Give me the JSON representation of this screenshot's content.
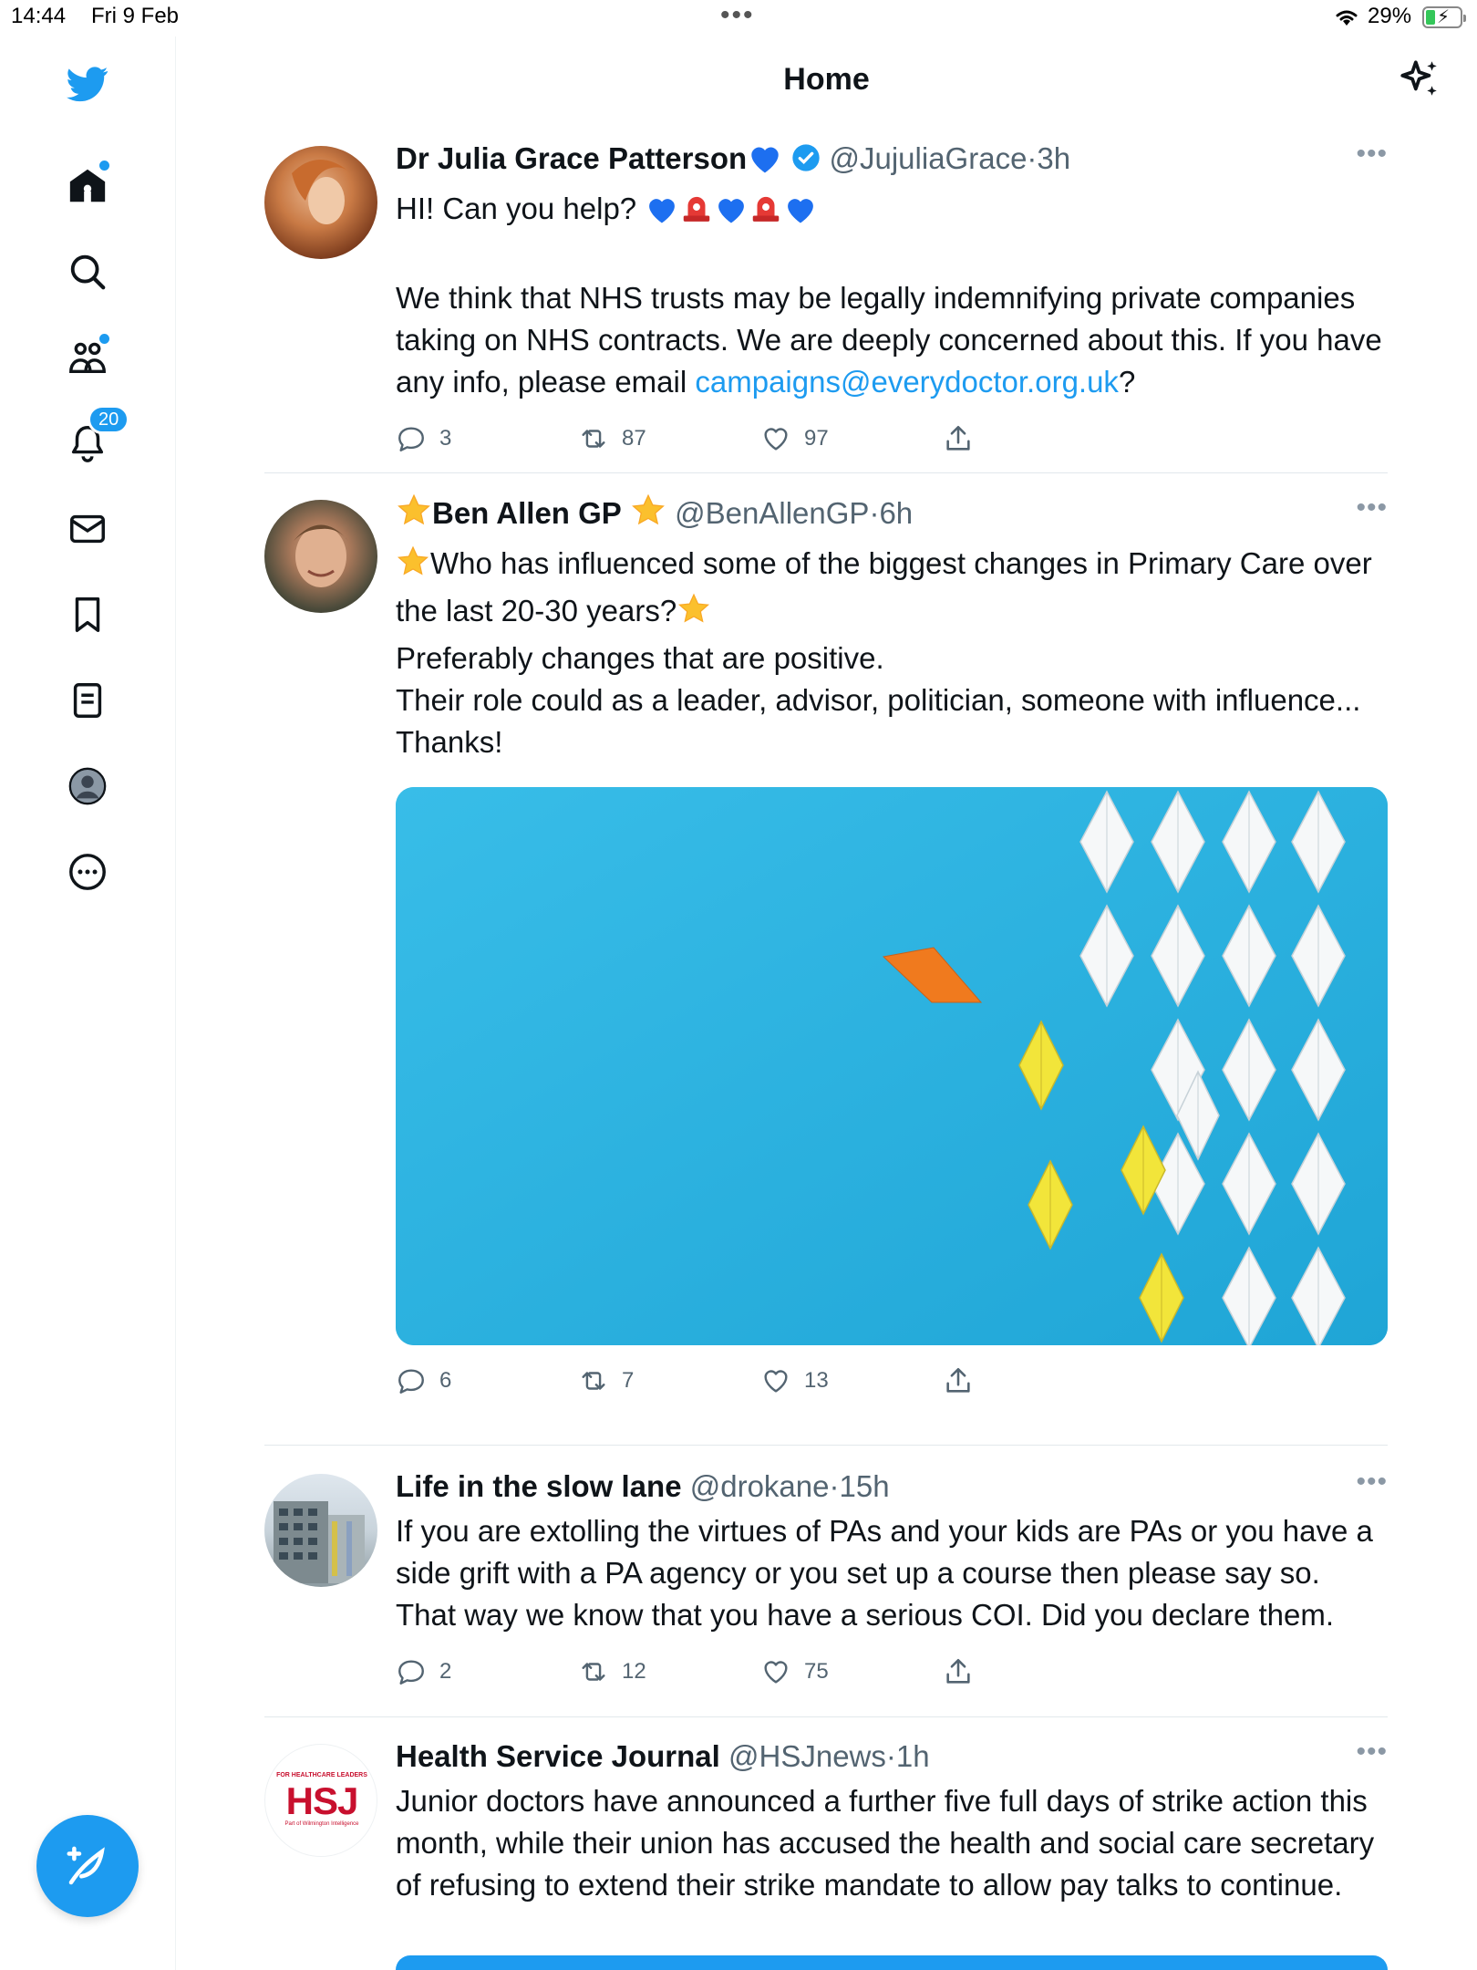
{
  "status_bar": {
    "time": "14:44",
    "date": "Fri 9 Feb",
    "battery": "29%"
  },
  "sidebar": {
    "items": [
      {
        "name": "home",
        "icon": "home-icon"
      },
      {
        "name": "explore",
        "icon": "search-icon"
      },
      {
        "name": "communities",
        "icon": "communities-icon"
      },
      {
        "name": "notifications",
        "icon": "bell-icon",
        "badge": "20"
      },
      {
        "name": "messages",
        "icon": "mail-icon"
      },
      {
        "name": "bookmarks",
        "icon": "bookmark-icon"
      },
      {
        "name": "lists",
        "icon": "lists-icon"
      },
      {
        "name": "profile",
        "icon": "profile-icon"
      },
      {
        "name": "more",
        "icon": "more-circle-icon"
      }
    ]
  },
  "header": {
    "title": "Home"
  },
  "tweets": [
    {
      "name": "Dr Julia Grace Patterson",
      "handle": "@JujuliaGrace",
      "sep": "·",
      "time": "3h",
      "line1": "HI! Can you help?",
      "line2": "We think that NHS trusts may be legally indemnifying private companies taking on NHS contracts. We are deeply concerned about this. If you have any info, please email",
      "link": "campaigns@everydoctor.org.uk",
      "line2_end": "?",
      "replies": "3",
      "retweets": "87",
      "likes": "97"
    },
    {
      "name": "Ben Allen GP",
      "handle": "@BenAllenGP",
      "sep": "·",
      "time": "6h",
      "line1": "Who has influenced some of the biggest changes in Primary Care over the last 20-30 years?",
      "line2": "Preferably changes that are positive.",
      "line3": "Their role could as a leader, advisor, politician, someone with influence...",
      "line4": "Thanks!",
      "replies": "6",
      "retweets": "7",
      "likes": "13"
    },
    {
      "name": "Life in the slow lane",
      "handle": "@drokane",
      "sep": "·",
      "time": "15h",
      "line1": "If you are extolling the virtues of PAs and your kids are PAs or you have a side grift with a PA agency or you set up a course then please say so. That way we know that you have a serious COI. Did you declare them.",
      "replies": "2",
      "retweets": "12",
      "likes": "75"
    },
    {
      "name": "Health Service Journal",
      "handle": "@HSJnews",
      "sep": "·",
      "time": "1h",
      "line1": "Junior doctors have announced a further five full days of strike action this month, while their union has accused the health and social care secretary of refusing to extend their strike mandate to allow pay talks to continue.",
      "avatar_text": "HSJ",
      "avatar_top": "FOR HEALTHCARE LEADERS",
      "avatar_bottom": "Part of Wilmington Intelligence"
    }
  ],
  "colors": {
    "accent": "#1d9bf0",
    "text": "#0f1419",
    "muted": "#536471"
  }
}
